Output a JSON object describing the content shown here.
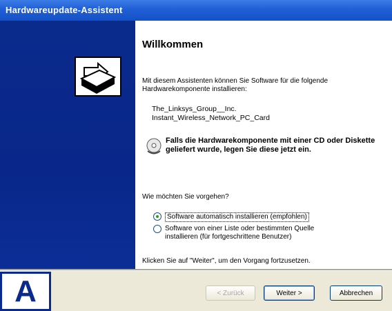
{
  "window": {
    "title": "Hardwareupdate-Assistent"
  },
  "content": {
    "heading": "Willkommen",
    "intro": "Mit diesem Assistenten können Sie Software für die folgende Hardwarekomponente installieren:",
    "device_line1": "The_Linksys_Group__Inc.",
    "device_line2": "Instant_Wireless_Network_PC_Card",
    "cd_note": "Falls die Hardwarekomponente mit einer CD oder Diskette geliefert wurde, legen Sie diese jetzt ein.",
    "question": "Wie möchten Sie vorgehen?",
    "option1": "Software automatisch installieren (empfohlen)",
    "option2_line1": "Software von einer Liste oder bestimmten Quelle",
    "option2_line2": "installieren (für fortgeschrittene Benutzer)",
    "continue_text": "Klicken Sie auf \"Weiter\", um den Vorgang fortzusetzen."
  },
  "buttons": {
    "back": "< Zurück",
    "next": "Weiter >",
    "cancel": "Abbrechen"
  },
  "marker": {
    "label": "A"
  },
  "icons": {
    "wizard": "hardware-wizard-icon",
    "cd": "cd-icon"
  },
  "colors": {
    "titlebar": "#1f5fd6",
    "sidepanel": "#0a2a8c",
    "dialog": "#ece9d8"
  }
}
